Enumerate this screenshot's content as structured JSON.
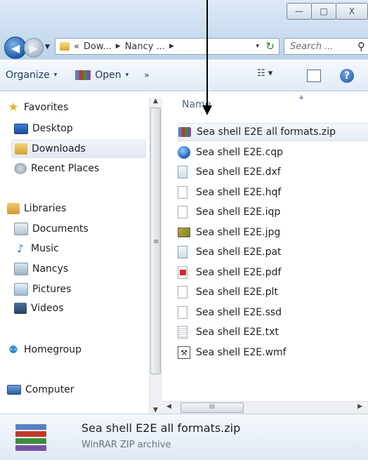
{
  "window": {
    "minimize_glyph": "—",
    "maximize_glyph": "□",
    "close_glyph": "X"
  },
  "address_bar": {
    "prefix": "«",
    "crumbs": [
      "Dow...",
      "Nancy ..."
    ],
    "separator": "▶",
    "dropdown_glyph": "▾",
    "refresh_glyph": "↻"
  },
  "search": {
    "placeholder": "Search ...",
    "icon_glyph": "⚲"
  },
  "toolbar": {
    "organize": "Organize",
    "open": "Open",
    "more": "»",
    "caret": "▾"
  },
  "nav_pane": {
    "favorites": "Favorites",
    "desktop": "Desktop",
    "downloads": "Downloads",
    "recent_places": "Recent Places",
    "libraries": "Libraries",
    "documents": "Documents",
    "music": "Music",
    "nancys": "Nancys",
    "pictures": "Pictures",
    "videos": "Videos",
    "homegroup": "Homegroup",
    "computer": "Computer"
  },
  "file_list": {
    "column_name": "Name",
    "files": [
      "Sea shell E2E all formats.zip",
      "Sea shell E2E.cqp",
      "Sea shell E2E.dxf",
      "Sea shell E2E.hqf",
      "Sea shell E2E.iqp",
      "Sea shell E2E.jpg",
      "Sea shell E2E.pat",
      "Sea shell E2E.pdf",
      "Sea shell E2E.plt",
      "Sea shell E2E.ssd",
      "Sea shell E2E.txt",
      "Sea shell E2E.wmf"
    ]
  },
  "details_pane": {
    "file_name": "Sea shell E2E all formats.zip",
    "file_type": "WinRAR ZIP archive"
  }
}
